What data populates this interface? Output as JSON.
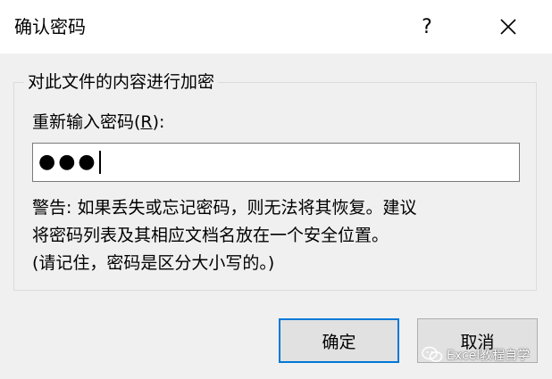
{
  "window": {
    "title": "确认密码",
    "help_label": "?",
    "close_label": "Close"
  },
  "group": {
    "legend": "对此文件的内容进行加密",
    "field_label_pre": "重新输入密码(",
    "field_label_accel": "R",
    "field_label_post": "):",
    "password_mask": "●●●"
  },
  "warning": {
    "line1": "警告: 如果丢失或忘记密码，则无法将其恢复。建议",
    "line2": "将密码列表及其相应文档名放在一个安全位置。",
    "line3": "(请记住，密码是区分大小写的。)"
  },
  "buttons": {
    "ok": "确定",
    "cancel": "取消"
  },
  "watermark": {
    "text": "Excel教程自学",
    "icon": "wechat-icon"
  },
  "colors": {
    "accent": "#0078d7",
    "background": "#f0f0f0",
    "titlebar": "#ffffff"
  }
}
